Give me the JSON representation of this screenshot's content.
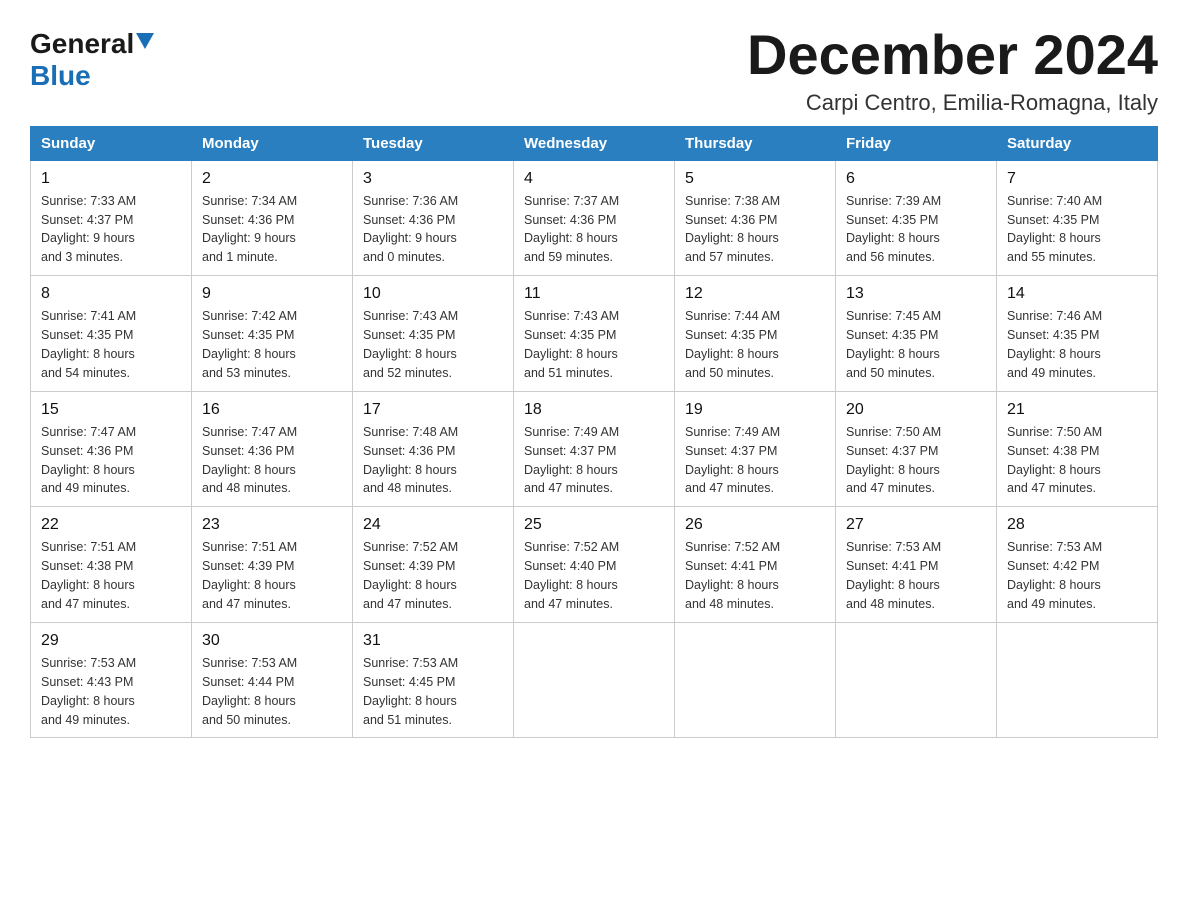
{
  "logo": {
    "general": "General",
    "blue": "Blue"
  },
  "title": "December 2024",
  "location": "Carpi Centro, Emilia-Romagna, Italy",
  "days_of_week": [
    "Sunday",
    "Monday",
    "Tuesday",
    "Wednesday",
    "Thursday",
    "Friday",
    "Saturday"
  ],
  "weeks": [
    [
      {
        "day": "1",
        "sunrise": "7:33 AM",
        "sunset": "4:37 PM",
        "daylight": "9 hours and 3 minutes."
      },
      {
        "day": "2",
        "sunrise": "7:34 AM",
        "sunset": "4:36 PM",
        "daylight": "9 hours and 1 minute."
      },
      {
        "day": "3",
        "sunrise": "7:36 AM",
        "sunset": "4:36 PM",
        "daylight": "9 hours and 0 minutes."
      },
      {
        "day": "4",
        "sunrise": "7:37 AM",
        "sunset": "4:36 PM",
        "daylight": "8 hours and 59 minutes."
      },
      {
        "day": "5",
        "sunrise": "7:38 AM",
        "sunset": "4:36 PM",
        "daylight": "8 hours and 57 minutes."
      },
      {
        "day": "6",
        "sunrise": "7:39 AM",
        "sunset": "4:35 PM",
        "daylight": "8 hours and 56 minutes."
      },
      {
        "day": "7",
        "sunrise": "7:40 AM",
        "sunset": "4:35 PM",
        "daylight": "8 hours and 55 minutes."
      }
    ],
    [
      {
        "day": "8",
        "sunrise": "7:41 AM",
        "sunset": "4:35 PM",
        "daylight": "8 hours and 54 minutes."
      },
      {
        "day": "9",
        "sunrise": "7:42 AM",
        "sunset": "4:35 PM",
        "daylight": "8 hours and 53 minutes."
      },
      {
        "day": "10",
        "sunrise": "7:43 AM",
        "sunset": "4:35 PM",
        "daylight": "8 hours and 52 minutes."
      },
      {
        "day": "11",
        "sunrise": "7:43 AM",
        "sunset": "4:35 PM",
        "daylight": "8 hours and 51 minutes."
      },
      {
        "day": "12",
        "sunrise": "7:44 AM",
        "sunset": "4:35 PM",
        "daylight": "8 hours and 50 minutes."
      },
      {
        "day": "13",
        "sunrise": "7:45 AM",
        "sunset": "4:35 PM",
        "daylight": "8 hours and 50 minutes."
      },
      {
        "day": "14",
        "sunrise": "7:46 AM",
        "sunset": "4:35 PM",
        "daylight": "8 hours and 49 minutes."
      }
    ],
    [
      {
        "day": "15",
        "sunrise": "7:47 AM",
        "sunset": "4:36 PM",
        "daylight": "8 hours and 49 minutes."
      },
      {
        "day": "16",
        "sunrise": "7:47 AM",
        "sunset": "4:36 PM",
        "daylight": "8 hours and 48 minutes."
      },
      {
        "day": "17",
        "sunrise": "7:48 AM",
        "sunset": "4:36 PM",
        "daylight": "8 hours and 48 minutes."
      },
      {
        "day": "18",
        "sunrise": "7:49 AM",
        "sunset": "4:37 PM",
        "daylight": "8 hours and 47 minutes."
      },
      {
        "day": "19",
        "sunrise": "7:49 AM",
        "sunset": "4:37 PM",
        "daylight": "8 hours and 47 minutes."
      },
      {
        "day": "20",
        "sunrise": "7:50 AM",
        "sunset": "4:37 PM",
        "daylight": "8 hours and 47 minutes."
      },
      {
        "day": "21",
        "sunrise": "7:50 AM",
        "sunset": "4:38 PM",
        "daylight": "8 hours and 47 minutes."
      }
    ],
    [
      {
        "day": "22",
        "sunrise": "7:51 AM",
        "sunset": "4:38 PM",
        "daylight": "8 hours and 47 minutes."
      },
      {
        "day": "23",
        "sunrise": "7:51 AM",
        "sunset": "4:39 PM",
        "daylight": "8 hours and 47 minutes."
      },
      {
        "day": "24",
        "sunrise": "7:52 AM",
        "sunset": "4:39 PM",
        "daylight": "8 hours and 47 minutes."
      },
      {
        "day": "25",
        "sunrise": "7:52 AM",
        "sunset": "4:40 PM",
        "daylight": "8 hours and 47 minutes."
      },
      {
        "day": "26",
        "sunrise": "7:52 AM",
        "sunset": "4:41 PM",
        "daylight": "8 hours and 48 minutes."
      },
      {
        "day": "27",
        "sunrise": "7:53 AM",
        "sunset": "4:41 PM",
        "daylight": "8 hours and 48 minutes."
      },
      {
        "day": "28",
        "sunrise": "7:53 AM",
        "sunset": "4:42 PM",
        "daylight": "8 hours and 49 minutes."
      }
    ],
    [
      {
        "day": "29",
        "sunrise": "7:53 AM",
        "sunset": "4:43 PM",
        "daylight": "8 hours and 49 minutes."
      },
      {
        "day": "30",
        "sunrise": "7:53 AM",
        "sunset": "4:44 PM",
        "daylight": "8 hours and 50 minutes."
      },
      {
        "day": "31",
        "sunrise": "7:53 AM",
        "sunset": "4:45 PM",
        "daylight": "8 hours and 51 minutes."
      },
      null,
      null,
      null,
      null
    ]
  ],
  "labels": {
    "sunrise": "Sunrise:",
    "sunset": "Sunset:",
    "daylight": "Daylight:"
  }
}
